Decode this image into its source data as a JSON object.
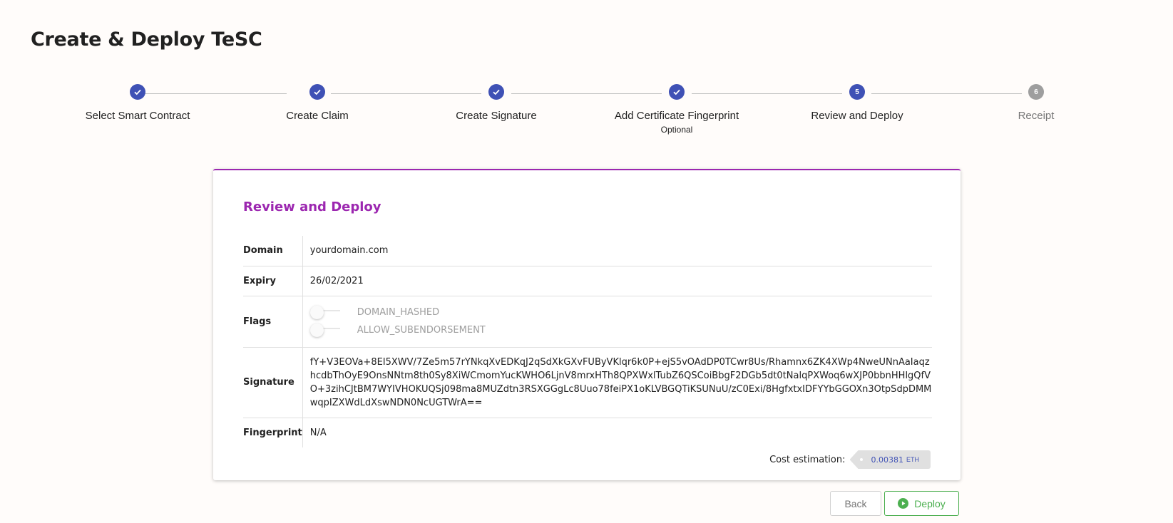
{
  "page": {
    "title": "Create & Deploy TeSC"
  },
  "stepper": {
    "steps": [
      {
        "label": "Select Smart Contract",
        "status": "done",
        "icon": "check-icon"
      },
      {
        "label": "Create Claim",
        "status": "done",
        "icon": "check-icon"
      },
      {
        "label": "Create Signature",
        "status": "done",
        "icon": "check-icon"
      },
      {
        "label": "Add Certificate Fingerprint",
        "sublabel": "Optional",
        "status": "done",
        "icon": "check-icon"
      },
      {
        "label": "Review and Deploy",
        "status": "active",
        "number": "5"
      },
      {
        "label": "Receipt",
        "status": "pending",
        "number": "6"
      }
    ]
  },
  "review": {
    "title": "Review and Deploy",
    "domain_label": "Domain",
    "domain_value": "yourdomain.com",
    "expiry_label": "Expiry",
    "expiry_value": "26/02/2021",
    "flags_label": "Flags",
    "flags": [
      {
        "label": "DOMAIN_HASHED",
        "enabled": false
      },
      {
        "label": "ALLOW_SUBENDORSEMENT",
        "enabled": false
      }
    ],
    "signature_label": "Signature",
    "signature_value": "fY+V3EOVa+8EI5XWV/7Ze5m57rYNkqXvEDKqJ2qSdXkGXvFUByVKlqr6k0P+ejS5vOAdDP0TCwr8Us/Rhamnx6ZK4XWp4NweUNnAaIaqzhcdbThOyE9OnsNNtm8th0Sy8XiWCmomYucKWHO6LjnV8mrxHTh8QPXWxlTubZ6QSCoiBbgF2DGb5dt0tNalqPXWoq6wXJP0bbnHHlgQfVO+3zihCJtBM7WYIVHOKUQSj098ma8MUZdtn3RSXGGgLc8Uuo78feiPX1oKLVBGQTiKSUNuU/zC0Exi/8HgfxtxIDFYYbGGOXn3OtpSdpDMMwqpIZXWdLdXswNDN0NcUGTWrA==",
    "fingerprint_label": "Fingerprint",
    "fingerprint_value": "N/A",
    "cost_label": "Cost estimation:",
    "cost_value": "0.00381",
    "cost_unit": "ETH"
  },
  "actions": {
    "back_label": "Back",
    "deploy_label": "Deploy"
  },
  "colors": {
    "primary": "#3f51b5",
    "accent": "#9c27b0",
    "success": "#4caf50",
    "pending": "#9e9e9e"
  }
}
